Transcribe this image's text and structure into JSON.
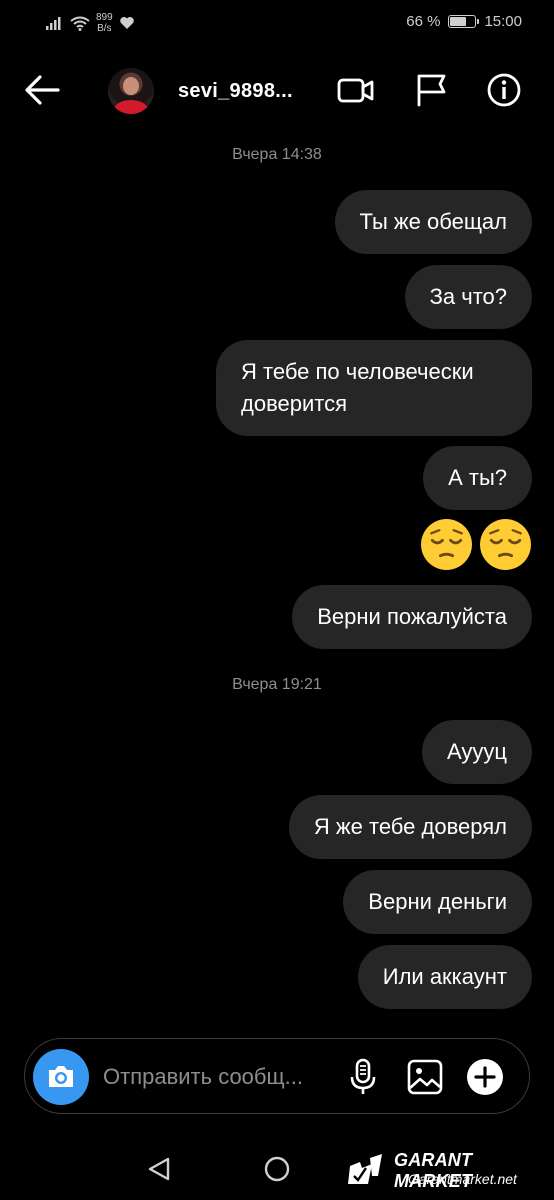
{
  "status_bar": {
    "network_speed_value": "899",
    "network_speed_unit": "B/s",
    "battery_percent": "66 %",
    "battery_level": 0.66,
    "time": "15:00"
  },
  "header": {
    "username": "sevi_9898..."
  },
  "messages": [
    {
      "type": "timestamp",
      "text": "Вчера 14:38"
    },
    {
      "type": "bubble",
      "text": "Ты же обещал"
    },
    {
      "type": "bubble",
      "text": "За что?"
    },
    {
      "type": "bubble",
      "text": "Я тебе по человечески доверится"
    },
    {
      "type": "bubble",
      "text": "А ты?"
    },
    {
      "type": "emoji",
      "text": "😔😔"
    },
    {
      "type": "bubble",
      "text": "Верни пожалуйста"
    },
    {
      "type": "timestamp",
      "text": "Вчера 19:21"
    },
    {
      "type": "bubble",
      "text": "Ауууц"
    },
    {
      "type": "bubble",
      "text": "Я же тебе доверял"
    },
    {
      "type": "bubble",
      "text": "Верни деньги"
    },
    {
      "type": "bubble",
      "text": "Или аккаунт"
    }
  ],
  "composer": {
    "placeholder": "Отправить сообщ..."
  },
  "watermark": {
    "title": "GARANT MARKET",
    "subtitle": "Garantmarket.net"
  },
  "colors": {
    "background": "#000000",
    "bubble": "#262626",
    "accent_blue": "#3897f0",
    "timestamp": "#8e8e8e"
  }
}
